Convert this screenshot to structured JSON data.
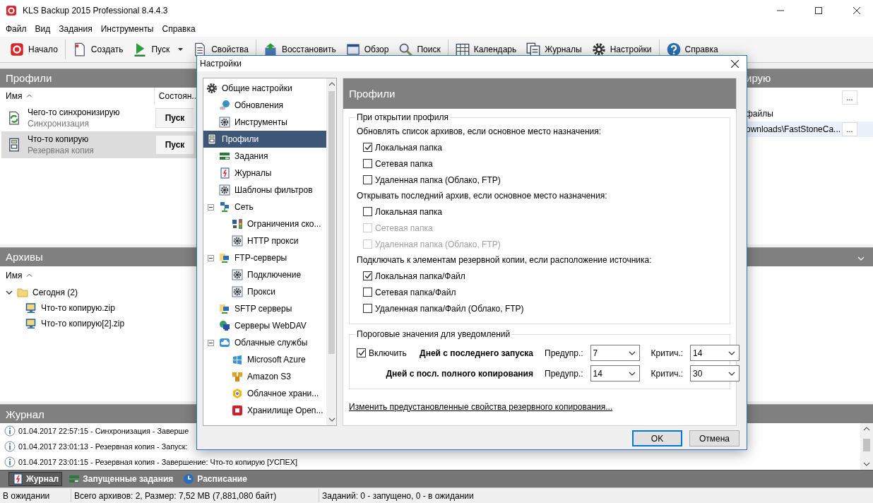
{
  "window": {
    "title": "KLS Backup 2015 Professional 8.4.4.3"
  },
  "menu": [
    "Файл",
    "Вид",
    "Задания",
    "Инструменты",
    "Справка"
  ],
  "toolbar": [
    [
      {
        "label": "Начало",
        "kind": "record",
        "dropdown": false
      }
    ],
    [
      {
        "label": "Создать",
        "kind": "newdoc",
        "dropdown": false
      },
      {
        "label": "Пуск",
        "kind": "play",
        "dropdown": true
      },
      {
        "label": "Свойства",
        "kind": "doc",
        "dropdown": false
      }
    ],
    [
      {
        "label": "Восстановить",
        "kind": "restore",
        "dropdown": false
      },
      {
        "label": "Обзор",
        "kind": "window",
        "dropdown": false
      },
      {
        "label": "Поиск",
        "kind": "search",
        "dropdown": false
      }
    ],
    [
      {
        "label": "Календарь",
        "kind": "calendar",
        "dropdown": false
      },
      {
        "label": "Журналы",
        "kind": "documents",
        "dropdown": false
      },
      {
        "label": "Настройки",
        "kind": "gear",
        "dropdown": false
      }
    ],
    [
      {
        "label": "Справка",
        "kind": "help",
        "dropdown": false
      }
    ]
  ],
  "profiles": {
    "title": "Профили",
    "columns": [
      "Имя",
      "Состоян.."
    ],
    "rows": [
      {
        "name": "Чего-то синхронизирую",
        "type": "Синхронизация",
        "kind": "sync",
        "action": "Пуск",
        "selected": false
      },
      {
        "name": "Что-то копирую",
        "type": "Резервная копия",
        "kind": "profile",
        "action": "Пуск",
        "selected": true
      }
    ]
  },
  "profile_details": {
    "title": "ирую",
    "header_button": "...",
    "rows": [
      {
        "text": "файлы",
        "selected": false
      },
      {
        "text": "ownloads\\FastStoneCa...",
        "button": "...",
        "selected": true
      }
    ]
  },
  "archives": {
    "title": "Архивы",
    "columns": [
      "Имя"
    ],
    "tree": [
      {
        "label": "Сегодня (2)",
        "kind": "folder",
        "expanded": true,
        "children": [
          {
            "label": "Что-то копирую.zip",
            "kind": "monitor"
          },
          {
            "label": "Что-то копирую[2].zip",
            "kind": "monitor"
          }
        ]
      }
    ]
  },
  "journal": {
    "title": "Журнал",
    "entries": [
      "01.04.2017 22:57:15 - Синхронизация - Заверше",
      "01.04.2017 23:01:13 - Резервная копия - Запуск:",
      "01.04.2017 23:01:15 - Резервная копия - Завершение: Что-то копирую [УСПЕХ]"
    ]
  },
  "bottom_tabs": [
    {
      "label": "Журнал",
      "kind": "journal",
      "selected": true
    },
    {
      "label": "Запущенные задания",
      "kind": "bars",
      "selected": false
    },
    {
      "label": "Расписание",
      "kind": "clock",
      "selected": false
    }
  ],
  "status_bar": [
    "В ожидании",
    "Всего архивов: 2, Размер: 7,52 MB (7,881,080 байт)",
    "Заданий: 0 - запущено, 0 - в ожидании"
  ],
  "dialog": {
    "title": "Настройки",
    "tree": [
      {
        "label": "Общие настройки",
        "kind": "gear",
        "selected": false,
        "expanded": true,
        "children": [
          {
            "label": "Обновления",
            "kind": "globe",
            "selected": false
          },
          {
            "label": "Инструменты",
            "kind": "geartool",
            "selected": false
          }
        ]
      },
      {
        "label": "Профили",
        "kind": "profile",
        "selected": true,
        "expanded": true,
        "children": [
          {
            "label": "Задания",
            "kind": "bars",
            "selected": false
          },
          {
            "label": "Журналы",
            "kind": "journal",
            "selected": false
          },
          {
            "label": "Шаблоны фильтров",
            "kind": "geartool",
            "selected": false
          },
          {
            "label": "Сеть",
            "kind": "network",
            "selected": false,
            "expanded": true,
            "children": [
              {
                "label": "Ограничения ско...",
                "kind": "traffic",
                "selected": false
              },
              {
                "label": "HTTP прокси",
                "kind": "geartool",
                "selected": false
              }
            ]
          },
          {
            "label": "FTP-серверы",
            "kind": "ftp",
            "selected": false,
            "expanded": true,
            "children": [
              {
                "label": "Подключение",
                "kind": "geartool",
                "selected": false
              },
              {
                "label": "Прокси",
                "kind": "geartool",
                "selected": false
              }
            ]
          },
          {
            "label": "SFTP серверы",
            "kind": "ftp",
            "selected": false
          },
          {
            "label": "Серверы WebDAV",
            "kind": "webdav",
            "selected": false
          },
          {
            "label": "Облачные службы",
            "kind": "cloud",
            "selected": false,
            "expanded": true,
            "children": [
              {
                "label": "Microsoft Azure",
                "kind": "azure",
                "selected": false
              },
              {
                "label": "Amazon S3",
                "kind": "amazon",
                "selected": false
              },
              {
                "label": "Облачное храни...",
                "kind": "google",
                "selected": false
              },
              {
                "label": "Хранилище Open...",
                "kind": "openstack",
                "selected": false
              }
            ]
          }
        ]
      }
    ],
    "page_title": "Профили",
    "group": {
      "title": "При открытии профиля",
      "sections": [
        {
          "label": "Обновлять список архивов, если основное место назначения:",
          "options": [
            {
              "label": "Локальная папка",
              "checked": true,
              "disabled": false
            },
            {
              "label": "Сетевая папка",
              "checked": false,
              "disabled": false
            },
            {
              "label": "Удаленная папка (Облако, FTP)",
              "checked": false,
              "disabled": false
            }
          ]
        },
        {
          "label": "Открывать последний архив, если основное место назначения:",
          "options": [
            {
              "label": "Локальная папка",
              "checked": false,
              "disabled": false
            },
            {
              "label": "Сетевая папка",
              "checked": false,
              "disabled": true
            },
            {
              "label": "Удаленная папка (Облако, FTP)",
              "checked": false,
              "disabled": true
            }
          ]
        },
        {
          "label": "Подключать к элементам резервной копии, если расположение источника:",
          "options": [
            {
              "label": "Локальная папка/Файл",
              "checked": true,
              "disabled": false
            },
            {
              "label": "Сетевая папка/Файл",
              "checked": false,
              "disabled": false
            },
            {
              "label": "Удаленная папка/Файл (Облако, FTP)",
              "checked": false,
              "disabled": false
            }
          ]
        }
      ]
    },
    "thresholds": {
      "title": "Пороговые значения для уведомлений",
      "enable": {
        "label": "Включить",
        "checked": true
      },
      "rows": [
        {
          "label": "Дней с последнего запуска",
          "warn_label": "Предупр.:",
          "warn": "7",
          "crit_label": "Критич.:",
          "crit": "14"
        },
        {
          "label": "Дней с посл. полного копирования",
          "warn_label": "Предупр.:",
          "warn": "14",
          "crit_label": "Критич.:",
          "crit": "30"
        }
      ]
    },
    "link": "Изменить предустановленные свойства резервного копирования...",
    "buttons": [
      {
        "label": "OK",
        "default": true
      },
      {
        "label": "Отмена",
        "default": false
      }
    ]
  }
}
